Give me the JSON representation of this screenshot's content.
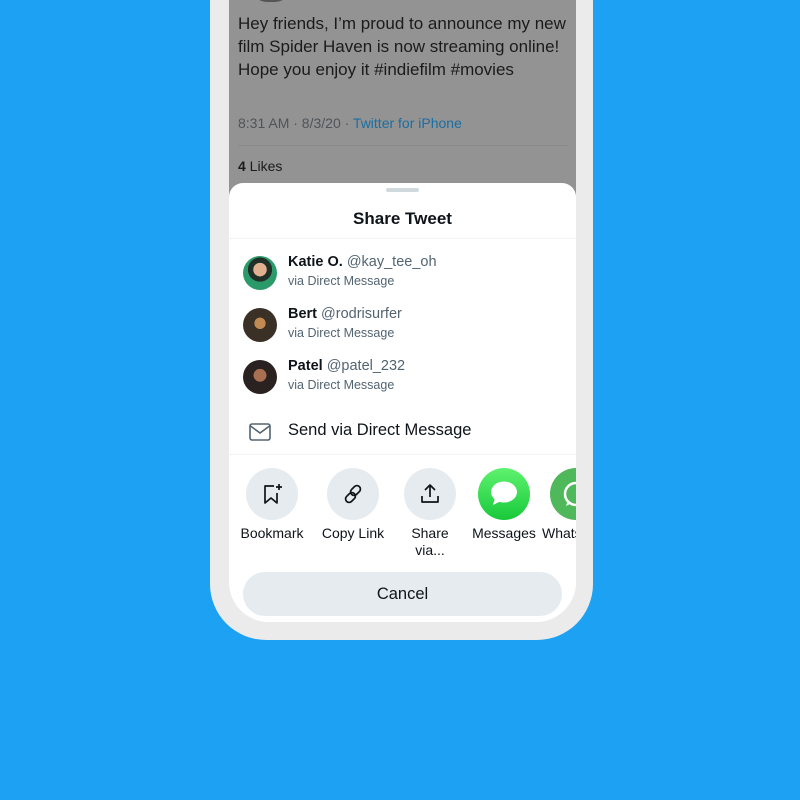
{
  "tweet": {
    "text": "Hey friends, I’m proud to announce my new film Spider Haven is now streaming online! Hope you enjoy it #indiefilm #movies",
    "time": "8:31 AM · 8/3/20 · ",
    "source": "Twitter for iPhone",
    "likes_count": "4",
    "likes_label": " Likes"
  },
  "sheet": {
    "title": "Share Tweet",
    "contacts": [
      {
        "name": "Katie O.",
        "handle": "@kay_tee_oh",
        "via": "via Direct Message"
      },
      {
        "name": "Bert",
        "handle": "@rodrisurfer",
        "via": "via Direct Message"
      },
      {
        "name": "Patel",
        "handle": "@patel_232",
        "via": "via Direct Message"
      }
    ],
    "dm_label": "Send via Direct Message",
    "actions": [
      {
        "label": "Bookmark",
        "icon": "bookmark-add-icon"
      },
      {
        "label": "Copy Link",
        "icon": "link-icon"
      },
      {
        "label": "Share via...",
        "icon": "share-icon"
      },
      {
        "label": "Messages",
        "icon": "messages-app-icon"
      },
      {
        "label": "WhatsApp",
        "icon": "whatsapp-icon"
      }
    ],
    "cancel_label": "Cancel"
  },
  "colors": {
    "background": "#1da1f2",
    "messages": "#2bd54c",
    "whatsapp": "#4fb85a",
    "link": "#1a6ea3"
  }
}
